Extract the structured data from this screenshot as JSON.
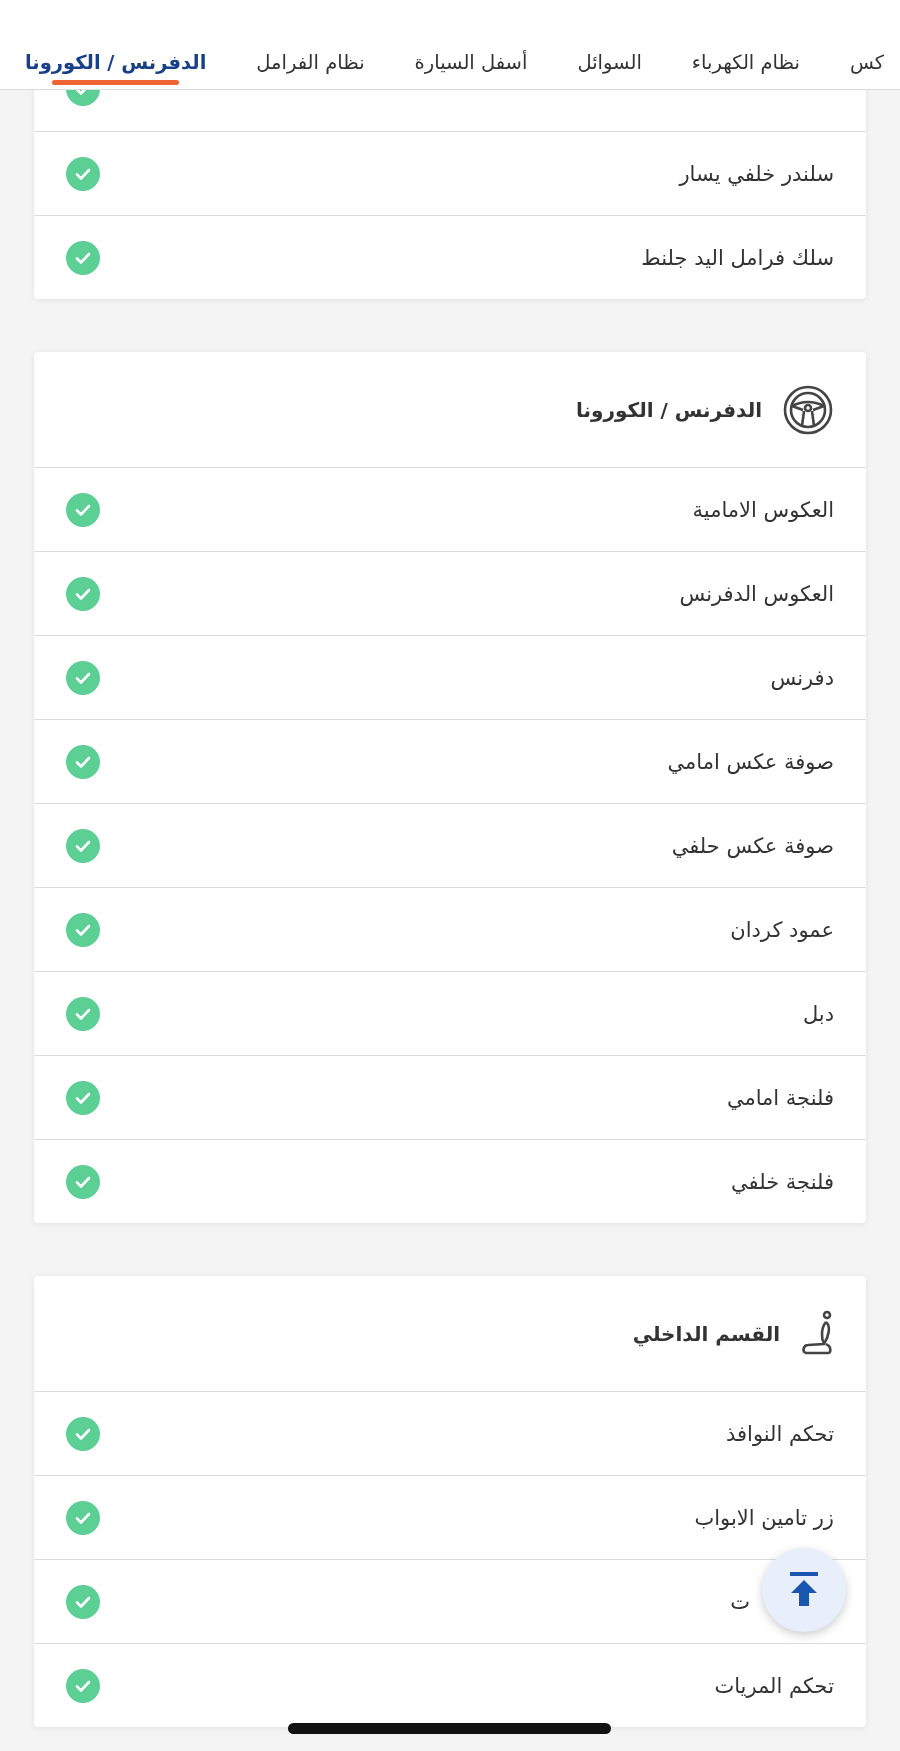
{
  "tabs": [
    {
      "label": "كس",
      "selected": false
    },
    {
      "label": "نظام الكهرباء",
      "selected": false
    },
    {
      "label": "السوائل",
      "selected": false
    },
    {
      "label": "أسفل السيارة",
      "selected": false
    },
    {
      "label": "نظام الفرامل",
      "selected": false
    },
    {
      "label": "الدفرنس / الكورونا",
      "selected": true
    }
  ],
  "sections": [
    {
      "items": [
        {
          "checked": true
        },
        {
          "label": "سلندر خلفي يسار",
          "checked": true
        },
        {
          "label": "سلك فرامل اليد جلنط",
          "checked": true
        }
      ]
    },
    {
      "title": "الدفرنس / الكورونا",
      "items": [
        {
          "label": "العكوس الامامية",
          "checked": true
        },
        {
          "label": "العكوس الدفرنس",
          "checked": true
        },
        {
          "label": "دفرنس",
          "checked": true
        },
        {
          "label": "صوفة عكس امامي",
          "checked": true
        },
        {
          "label": "صوفة عكس حلفي",
          "checked": true
        },
        {
          "label": "عمود كردان",
          "checked": true
        },
        {
          "label": "دبل",
          "checked": true
        },
        {
          "label": "فلنجة امامي",
          "checked": true
        },
        {
          "label": "فلنجة خلفي",
          "checked": true
        }
      ]
    },
    {
      "title": "القسم الداخلي",
      "items": [
        {
          "label": "تحكم النوافذ",
          "checked": true
        },
        {
          "label": "زر تامين الابواب",
          "checked": true
        },
        {
          "kind": "partly-covered",
          "label": "ت",
          "checked": true
        },
        {
          "label": "تحكم المريات",
          "checked": true
        }
      ]
    }
  ]
}
